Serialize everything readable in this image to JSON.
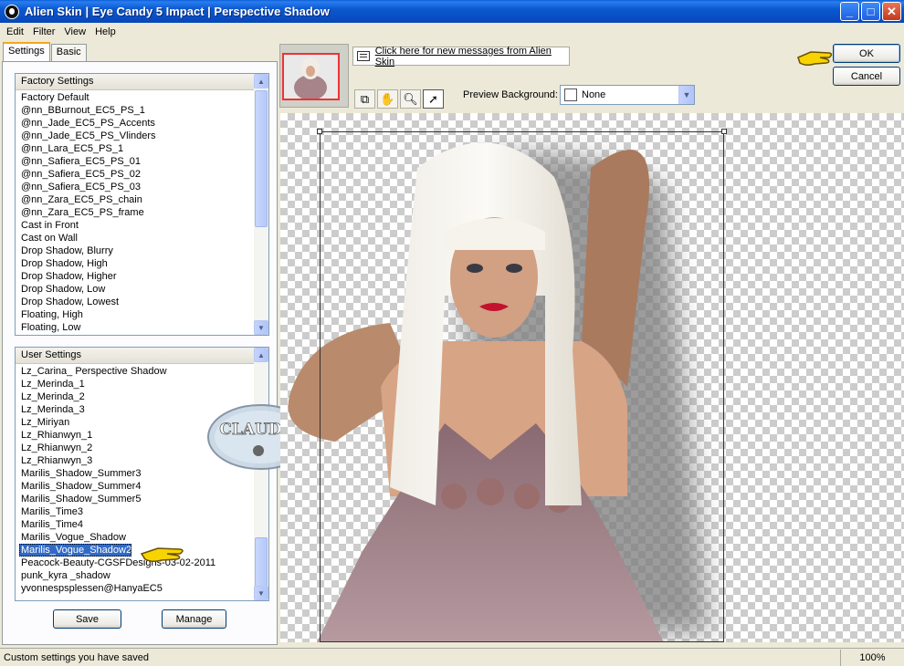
{
  "window": {
    "title": "Alien Skin  |  Eye Candy 5 Impact  |  Perspective Shadow",
    "controls": {
      "minimize": "_",
      "maximize": "□",
      "close": "✕"
    }
  },
  "menu": [
    "Edit",
    "Filter",
    "View",
    "Help"
  ],
  "tabs": [
    "Settings",
    "Basic"
  ],
  "factory": {
    "header": "Factory Settings",
    "items": [
      "Factory Default",
      "@nn_BBurnout_EC5_PS_1",
      "@nn_Jade_EC5_PS_Accents",
      "@nn_Jade_EC5_PS_Vlinders",
      "@nn_Lara_EC5_PS_1",
      "@nn_Safiera_EC5_PS_01",
      "@nn_Safiera_EC5_PS_02",
      "@nn_Safiera_EC5_PS_03",
      "@nn_Zara_EC5_PS_chain",
      "@nn_Zara_EC5_PS_frame",
      "Cast in Front",
      "Cast on Wall",
      "Drop Shadow, Blurry",
      "Drop Shadow, High",
      "Drop Shadow, Higher",
      "Drop Shadow, Low",
      "Drop Shadow, Lowest",
      "Floating, High",
      "Floating, Low"
    ]
  },
  "user": {
    "header": "User Settings",
    "items": [
      "Lz_Carina_ Perspective Shadow",
      "Lz_Merinda_1",
      "Lz_Merinda_2",
      "Lz_Merinda_3",
      "Lz_Miriyan",
      "Lz_Rhianwyn_1",
      "Lz_Rhianwyn_2",
      "Lz_Rhianwyn_3",
      "Marilis_Shadow_Summer3",
      "Marilis_Shadow_Summer4",
      "Marilis_Shadow_Summer5",
      "Marilis_Time3",
      "Marilis_Time4",
      "Marilis_Vogue_Shadow",
      "Marilis_Vogue_Shadow2",
      "Peacock-Beauty-CGSFDesigns-03-02-2011",
      "punk_kyra _shadow",
      "yvonnespsplessen@HanyaEC5"
    ],
    "selected_index": 14
  },
  "buttons": {
    "save": "Save",
    "manage": "Manage",
    "ok": "OK",
    "cancel": "Cancel"
  },
  "messages_link": "Click here for new messages from Alien Skin",
  "preview_background": {
    "label": "Preview Background:",
    "value": "None"
  },
  "watermark": "CLAUDIA",
  "status": {
    "text": "Custom settings you have saved",
    "zoom": "100%"
  },
  "colors": {
    "titlebar": "#0a58d0",
    "selection": "#316ac5",
    "panel": "#ece9d8"
  }
}
